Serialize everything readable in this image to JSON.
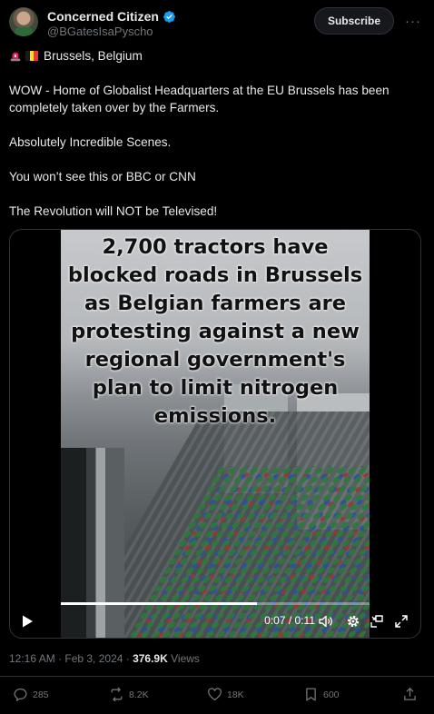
{
  "author": {
    "name": "Concerned Citizen",
    "handle": "@BGatesIsaPyscho",
    "verified_color": "#1d9bf0"
  },
  "header": {
    "subscribe_label": "Subscribe",
    "more_label": "···"
  },
  "post": {
    "location": "Brussels, Belgium",
    "paragraphs": [
      "WOW - Home of Globalist Headquarters at the EU Brussels has been completely taken over by the Farmers.",
      "Absolutely Incredible Scenes.",
      "You won’t see this or BBC or CNN",
      "The Revolution will NOT be Televised!"
    ]
  },
  "video": {
    "caption_lines": [
      "2,700 tractors have",
      "blocked roads in Brussels",
      "as Belgian farmers are",
      "protesting against a new",
      "regional government's",
      "plan to limit nitrogen",
      "emissions."
    ],
    "time": "0:07 / 0:11",
    "progress": 0.636,
    "icons": [
      "play-icon",
      "volume-icon",
      "settings-icon",
      "pip-icon",
      "fullscreen-icon"
    ]
  },
  "meta": {
    "timestamp": "12:16 AM · Feb 3, 2024 · ",
    "views_count": "376.9K",
    "views_label": " Views"
  },
  "actions": {
    "replies": "285",
    "reposts": "8.2K",
    "likes": "18K",
    "bookmarks": "600"
  },
  "colors": {
    "background": "#000000",
    "text": "#e7e9ea",
    "muted": "#71767b",
    "border": "#2f3336"
  }
}
